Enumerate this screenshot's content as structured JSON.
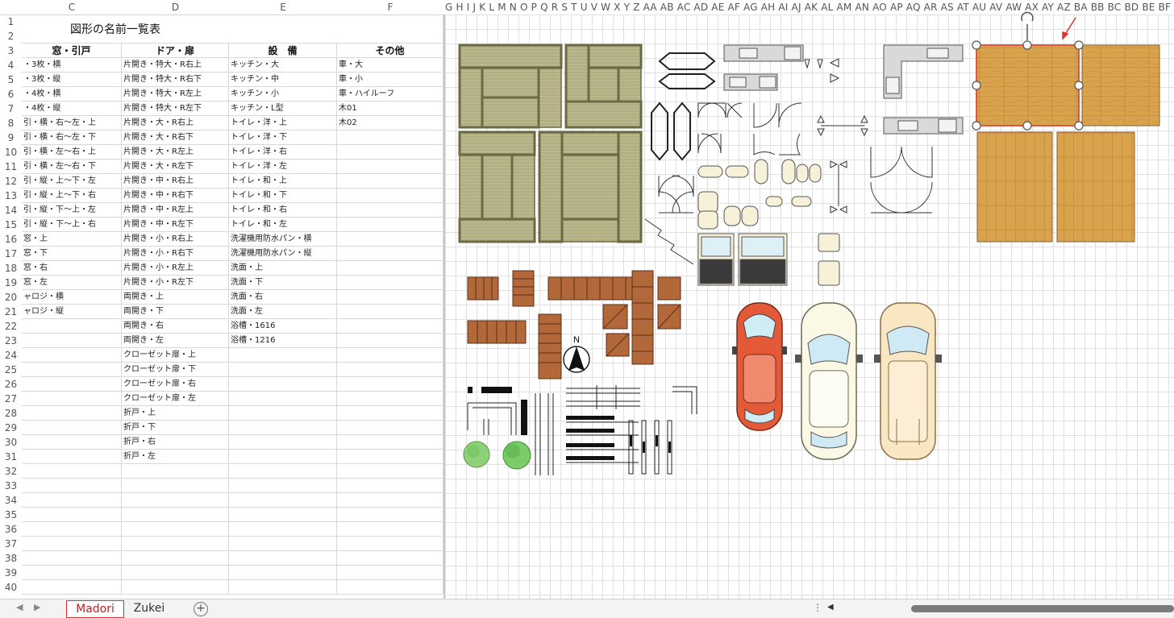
{
  "col_headers": [
    "C",
    "D",
    "E",
    "F"
  ],
  "col_letters": "G H I J K L M N O P Q R S T U V W X Y Z AA AB AC AD AE AF AG AH AI AJ AK AL AM AN AO AP AQ AR AS AT AU AV AW AX AY AZ BA BB BC BD BE BF BG BH BI",
  "row_numbers": [
    "1",
    "2",
    "3",
    "4",
    "5",
    "6",
    "7",
    "8",
    "9",
    "10",
    "11",
    "12",
    "13",
    "14",
    "15",
    "16",
    "17",
    "18",
    "19",
    "20",
    "21",
    "22",
    "23",
    "24",
    "25",
    "26",
    "27",
    "28",
    "29",
    "30",
    "31",
    "32",
    "33",
    "34",
    "35",
    "36",
    "37",
    "38",
    "39",
    "40"
  ],
  "title": "図形の名前一覧表",
  "table_headers": [
    "窓・引戸",
    "ドア・扉",
    "設　備",
    "その他"
  ],
  "rows": [
    [
      "・3枚・横",
      "片開き・特大・R右上",
      "キッチン・大",
      "車・大"
    ],
    [
      "・3枚・縦",
      "片開き・特大・R右下",
      "キッチン・中",
      "車・小"
    ],
    [
      "・4枚・横",
      "片開き・特大・R左上",
      "キッチン・小",
      "車・ハイルーフ"
    ],
    [
      "・4枚・縦",
      "片開き・特大・R左下",
      "キッチン・L型",
      "木01"
    ],
    [
      "引・横・右〜左・上",
      "片開き・大・R右上",
      "トイレ・洋・上",
      "木02"
    ],
    [
      "引・横・右〜左・下",
      "片開き・大・R右下",
      "トイレ・洋・下",
      ""
    ],
    [
      "引・横・左〜右・上",
      "片開き・大・R左上",
      "トイレ・洋・右",
      ""
    ],
    [
      "引・横・左〜右・下",
      "片開き・大・R左下",
      "トイレ・洋・左",
      ""
    ],
    [
      "引・縦・上〜下・左",
      "片開き・中・R右上",
      "トイレ・和・上",
      ""
    ],
    [
      "引・縦・上〜下・右",
      "片開き・中・R右下",
      "トイレ・和・下",
      ""
    ],
    [
      "引・縦・下〜上・左",
      "片開き・中・R左上",
      "トイレ・和・右",
      ""
    ],
    [
      "引・縦・下〜上・右",
      "片開き・中・R左下",
      "トイレ・和・左",
      ""
    ],
    [
      "窓・上",
      "片開き・小・R右上",
      "洗濯機用防水パン・横",
      ""
    ],
    [
      "窓・下",
      "片開き・小・R右下",
      "洗濯機用防水パン・縦",
      ""
    ],
    [
      "窓・右",
      "片開き・小・R左上",
      "洗面・上",
      ""
    ],
    [
      "窓・左",
      "片開き・小・R左下",
      "洗面・下",
      ""
    ],
    [
      "ャロジ・横",
      "両開き・上",
      "洗面・右",
      ""
    ],
    [
      "ャロジ・縦",
      "両開き・下",
      "洗面・左",
      ""
    ],
    [
      "",
      "両開き・右",
      "浴槽・1616",
      ""
    ],
    [
      "",
      "両開き・左",
      "浴槽・1216",
      ""
    ],
    [
      "",
      "クローゼット扉・上",
      "",
      ""
    ],
    [
      "",
      "クローゼット扉・下",
      "",
      ""
    ],
    [
      "",
      "クローゼット扉・右",
      "",
      ""
    ],
    [
      "",
      "クローゼット扉・左",
      "",
      ""
    ],
    [
      "",
      "折戸・上",
      "",
      ""
    ],
    [
      "",
      "折戸・下",
      "",
      ""
    ],
    [
      "",
      "折戸・右",
      "",
      ""
    ],
    [
      "",
      "折戸・左",
      "",
      ""
    ]
  ],
  "north_label": "N",
  "sheet_tabs": [
    "Madori",
    "Zukei"
  ],
  "add_sheet": "+",
  "icons": {
    "prev": "◀",
    "next": "▶",
    "more": "⋮",
    "scroll_left": "◀"
  },
  "colors": {
    "tatami": "#b7b587",
    "wood": "#d8a04a",
    "stair": "#b3683a",
    "car_red": "#e45a38",
    "selection": "#e03030"
  }
}
